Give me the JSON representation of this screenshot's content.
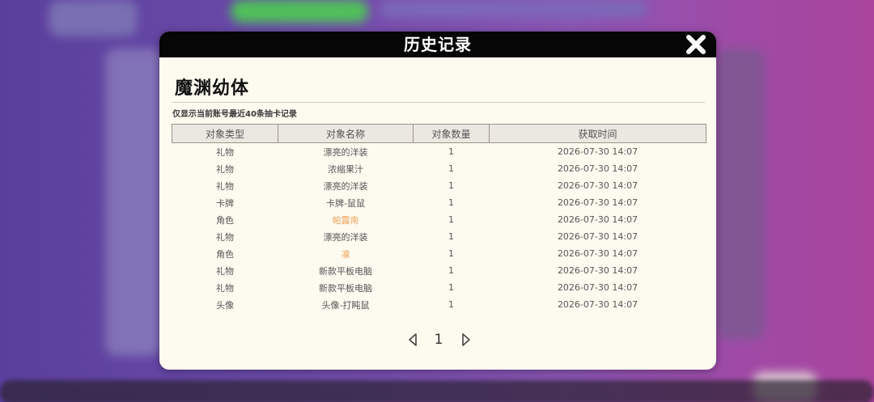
{
  "modal": {
    "title": "历史记录",
    "pool_title": "魔渊幼体",
    "notice": "仅显示当前账号最近40条抽卡记录"
  },
  "table": {
    "columns": [
      "对象类型",
      "对象名称",
      "对象数量",
      "获取时间"
    ],
    "rows": [
      {
        "type": "礼物",
        "name": "漂亮的洋装",
        "qty": "1",
        "time": "2026-07-30 14:07",
        "highlight": false
      },
      {
        "type": "礼物",
        "name": "浓缩果汁",
        "qty": "1",
        "time": "2026-07-30 14:07",
        "highlight": false
      },
      {
        "type": "礼物",
        "name": "漂亮的洋装",
        "qty": "1",
        "time": "2026-07-30 14:07",
        "highlight": false
      },
      {
        "type": "卡牌",
        "name": "卡牌-鼠鼠",
        "qty": "1",
        "time": "2026-07-30 14:07",
        "highlight": false
      },
      {
        "type": "角色",
        "name": "帕露南",
        "qty": "1",
        "time": "2026-07-30 14:07",
        "highlight": true
      },
      {
        "type": "礼物",
        "name": "漂亮的洋装",
        "qty": "1",
        "time": "2026-07-30 14:07",
        "highlight": false
      },
      {
        "type": "角色",
        "name": "凛",
        "qty": "1",
        "time": "2026-07-30 14:07",
        "highlight": true
      },
      {
        "type": "礼物",
        "name": "新款平板电脑",
        "qty": "1",
        "time": "2026-07-30 14:07",
        "highlight": false
      },
      {
        "type": "礼物",
        "name": "新款平板电脑",
        "qty": "1",
        "time": "2026-07-30 14:07",
        "highlight": false
      },
      {
        "type": "头像",
        "name": "头像-打盹鼠",
        "qty": "1",
        "time": "2026-07-30 14:07",
        "highlight": false
      }
    ]
  },
  "pagination": {
    "current_page": "1",
    "prev_icon": "triangle-left-outline-icon",
    "next_icon": "triangle-right-outline-icon"
  },
  "icons": {
    "close": "close-icon"
  },
  "colors": {
    "header_bg": "#060606",
    "panel_bg": "#fdfbf0",
    "highlight_text": "#f0a35e",
    "table_header_bg": "#ebe8e2"
  }
}
